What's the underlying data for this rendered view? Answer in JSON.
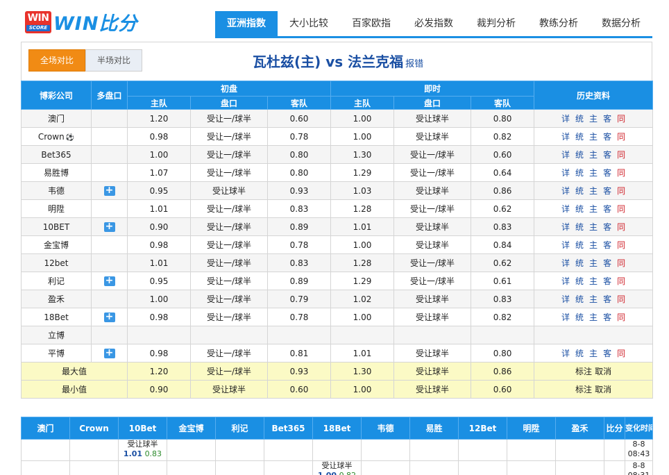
{
  "brand": {
    "badge_top": "WIN",
    "badge_bottom": "SCORE",
    "name": "WIN比分"
  },
  "nav": [
    {
      "label": "亚洲指数",
      "active": true
    },
    {
      "label": "大小比较"
    },
    {
      "label": "百家欧指"
    },
    {
      "label": "必发指数"
    },
    {
      "label": "裁判分析"
    },
    {
      "label": "教练分析"
    },
    {
      "label": "数据分析"
    }
  ],
  "match": {
    "tab_full": "全场对比",
    "tab_half": "半场对比",
    "title": "瓦杜兹(主) vs 法兰克福",
    "report": "报错"
  },
  "odds_table": {
    "headers": {
      "company": "博彩公司",
      "multi": "多盘口",
      "initial": "初盘",
      "live": "即时",
      "history": "历史资料",
      "home": "主队",
      "handicap": "盘口",
      "away": "客队"
    },
    "history_links": [
      "详",
      "统",
      "主",
      "客",
      "同"
    ],
    "rows": [
      {
        "company": "澳门",
        "plus": false,
        "init_h": "1.20",
        "init_p": "受让一/球半",
        "init_a": "0.60",
        "live_h": "1.00",
        "live_p": "受让球半",
        "live_a": "0.80",
        "hist": true
      },
      {
        "company": "Crown",
        "ball": "⚽",
        "plus": false,
        "init_h": "0.98",
        "init_p": "受让一/球半",
        "init_a": "0.78",
        "live_h": "1.00",
        "live_p": "受让球半",
        "live_a": "0.82",
        "hist": true
      },
      {
        "company": "Bet365",
        "plus": false,
        "init_h": "1.00",
        "init_p": "受让一/球半",
        "init_a": "0.80",
        "live_h": "1.30",
        "live_p": "受让一/球半",
        "live_a": "0.60",
        "hist": true
      },
      {
        "company": "易胜博",
        "plus": false,
        "init_h": "1.07",
        "init_p": "受让一/球半",
        "init_a": "0.80",
        "live_h": "1.29",
        "live_p": "受让一/球半",
        "live_a": "0.64",
        "hist": true
      },
      {
        "company": "韦德",
        "plus": true,
        "init_h": "0.95",
        "init_p": "受让球半",
        "init_a": "0.93",
        "live_h": "1.03",
        "live_p": "受让球半",
        "live_a": "0.86",
        "hist": true
      },
      {
        "company": "明陞",
        "plus": false,
        "init_h": "1.01",
        "init_p": "受让一/球半",
        "init_a": "0.83",
        "live_h": "1.28",
        "live_p": "受让一/球半",
        "live_a": "0.62",
        "hist": true
      },
      {
        "company": "10BET",
        "plus": true,
        "init_h": "0.90",
        "init_p": "受让一/球半",
        "init_a": "0.89",
        "live_h": "1.01",
        "live_p": "受让球半",
        "live_a": "0.83",
        "hist": true
      },
      {
        "company": "金宝博",
        "plus": false,
        "init_h": "0.98",
        "init_p": "受让一/球半",
        "init_a": "0.78",
        "live_h": "1.00",
        "live_p": "受让球半",
        "live_a": "0.84",
        "hist": true
      },
      {
        "company": "12bet",
        "plus": false,
        "init_h": "1.01",
        "init_p": "受让一/球半",
        "init_a": "0.83",
        "live_h": "1.28",
        "live_p": "受让一/球半",
        "live_a": "0.62",
        "hist": true
      },
      {
        "company": "利记",
        "plus": true,
        "init_h": "0.95",
        "init_p": "受让一/球半",
        "init_a": "0.89",
        "live_h": "1.29",
        "live_p": "受让一/球半",
        "live_a": "0.61",
        "hist": true
      },
      {
        "company": "盈禾",
        "plus": false,
        "init_h": "1.00",
        "init_p": "受让一/球半",
        "init_a": "0.79",
        "live_h": "1.02",
        "live_p": "受让球半",
        "live_a": "0.83",
        "hist": true
      },
      {
        "company": "18Bet",
        "plus": true,
        "init_h": "0.98",
        "init_p": "受让一/球半",
        "init_a": "0.78",
        "live_h": "1.00",
        "live_p": "受让球半",
        "live_a": "0.82",
        "hist": true
      },
      {
        "company": "立博",
        "plus": false,
        "init_h": "",
        "init_p": "",
        "init_a": "",
        "live_h": "",
        "live_p": "",
        "live_a": "",
        "hist": false
      },
      {
        "company": "平博",
        "plus": true,
        "init_h": "0.98",
        "init_p": "受让一/球半",
        "init_a": "0.81",
        "live_h": "1.01",
        "live_p": "受让球半",
        "live_a": "0.80",
        "hist": true
      }
    ],
    "stats": [
      {
        "label": "最大值",
        "init_h": "1.20",
        "init_p": "受让一/球半",
        "init_a": "0.93",
        "live_h": "1.30",
        "live_p": "受让球半",
        "live_a": "0.86",
        "mark": "标注",
        "cancel": "取消"
      },
      {
        "label": "最小值",
        "init_h": "0.90",
        "init_p": "受让球半",
        "init_a": "0.60",
        "live_h": "1.00",
        "live_p": "受让球半",
        "live_a": "0.60",
        "mark": "标注",
        "cancel": "取消"
      }
    ]
  },
  "change_table": {
    "headers": [
      "澳门",
      "Crown",
      "10Bet",
      "金宝博",
      "利记",
      "Bet365",
      "18Bet",
      "韦德",
      "易胜",
      "12Bet",
      "明陞",
      "盈禾",
      "比分",
      "变化时间"
    ],
    "rows": [
      {
        "col": 2,
        "pan": "受让球半",
        "v1": "1.01",
        "v2": "0.83",
        "date": "8-8",
        "time": "08:43"
      },
      {
        "col": 6,
        "pan": "受让球半",
        "v1": "1.00",
        "v2": "0.82",
        "date": "8-8",
        "time": "08:31"
      }
    ]
  }
}
